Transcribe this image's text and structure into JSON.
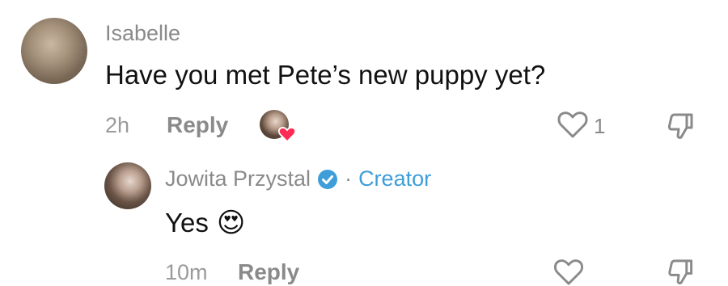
{
  "comments": [
    {
      "username": "Isabelle",
      "text": "Have you met Pete’s new puppy yet?",
      "time": "2h",
      "reply_label": "Reply",
      "likes": "1"
    },
    {
      "username": "Jowita Przystal",
      "creator_label": "Creator",
      "separator": "·",
      "text": "Yes",
      "emoji": "😍",
      "time": "10m",
      "reply_label": "Reply"
    }
  ],
  "colors": {
    "creator_accent": "#3d9ed9",
    "heart_red": "#fe2c55"
  }
}
